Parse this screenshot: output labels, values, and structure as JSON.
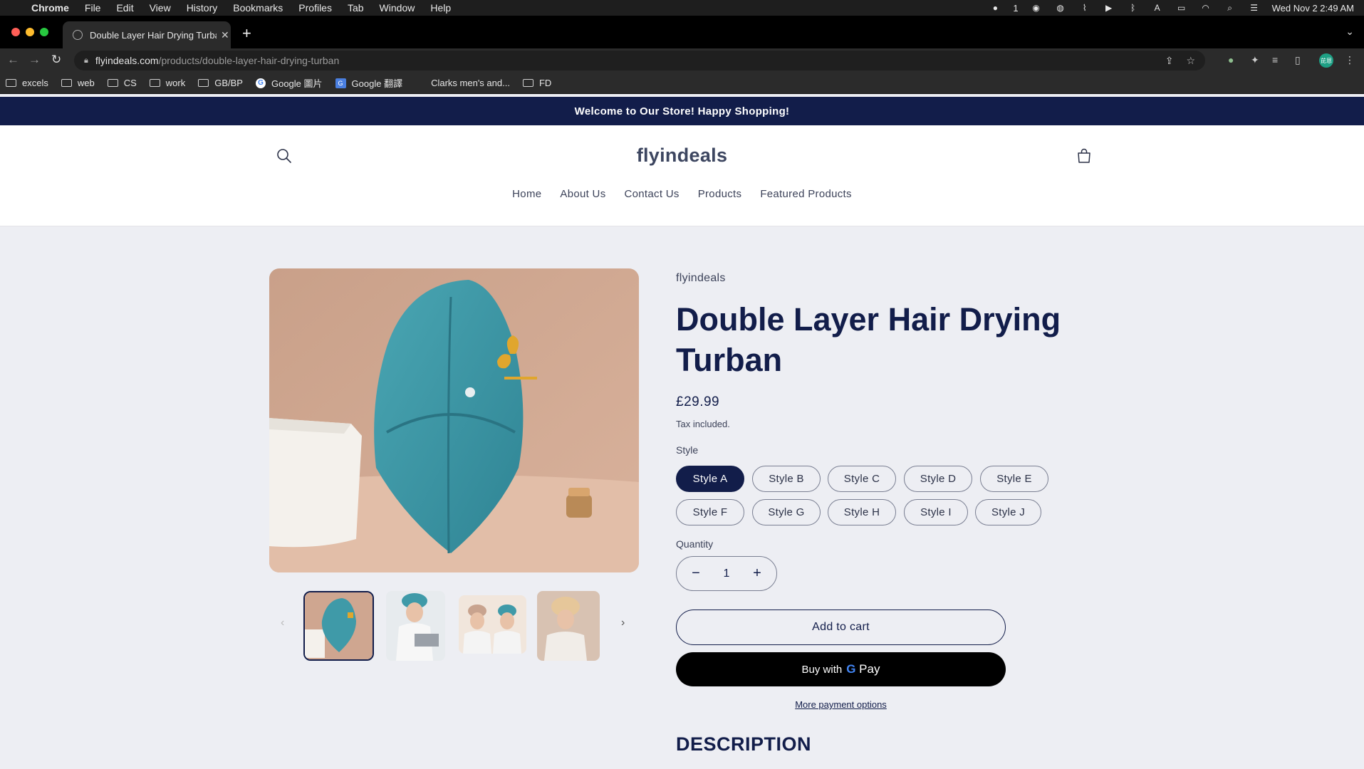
{
  "os_menu": {
    "app": "Chrome",
    "items": [
      "File",
      "Edit",
      "View",
      "History",
      "Bookmarks",
      "Profiles",
      "Tab",
      "Window",
      "Help"
    ],
    "wechat_count": "1",
    "datetime": "Wed Nov 2  2:49 AM"
  },
  "browser": {
    "tab_title": "Double Layer Hair Drying Turban",
    "url_host": "flyindeals.com",
    "url_path": "/products/double-layer-hair-drying-turban",
    "profile_initials": "芘恩",
    "bookmarks": [
      {
        "label": "excels",
        "icon": "folder-icon"
      },
      {
        "label": "web",
        "icon": "folder-icon"
      },
      {
        "label": "CS",
        "icon": "folder-icon"
      },
      {
        "label": "work",
        "icon": "folder-icon"
      },
      {
        "label": "GB/BP",
        "icon": "folder-icon"
      },
      {
        "label": "Google 圖片",
        "icon": "google-icon"
      },
      {
        "label": "Google 翻譯",
        "icon": "google-translate-icon"
      },
      {
        "label": "Clarks men's and...",
        "icon": "site-icon"
      },
      {
        "label": "FD",
        "icon": "folder-icon"
      }
    ]
  },
  "store": {
    "announcement": "Welcome to Our Store! Happy Shopping!",
    "logo": "flyindeals",
    "nav": [
      "Home",
      "About Us",
      "Contact Us",
      "Products",
      "Featured Products"
    ]
  },
  "product": {
    "vendor": "flyindeals",
    "title": "Double Layer Hair Drying Turban",
    "price": "£29.99",
    "tax_note": "Tax included.",
    "style_label": "Style",
    "styles": [
      "Style A",
      "Style B",
      "Style C",
      "Style D",
      "Style E",
      "Style F",
      "Style G",
      "Style H",
      "Style I",
      "Style J"
    ],
    "selected_style": "Style A",
    "quantity_label": "Quantity",
    "quantity": "1",
    "add_to_cart": "Add to cart",
    "buy_with": "Buy with",
    "gpay_g": "G",
    "gpay_pay": " Pay",
    "more_payment": "More payment options",
    "description_heading": "DESCRIPTION"
  },
  "colors": {
    "navy": "#121d4a",
    "turban_teal": "#3f9aa8",
    "background": "#edeef3"
  }
}
